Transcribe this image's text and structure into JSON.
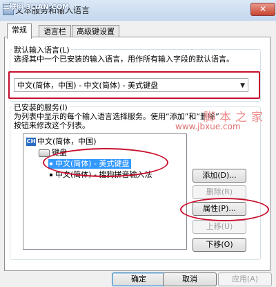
{
  "window": {
    "title": "文本服务和输入语言",
    "watermark_top": "三联网 3LIAN.COM",
    "close_glyph": "✕"
  },
  "tabs": [
    {
      "label": "常规",
      "active": true
    },
    {
      "label": "语言栏",
      "active": false
    },
    {
      "label": "高级键设置",
      "active": false
    }
  ],
  "default_language": {
    "group_label": "默认输入语言(L)",
    "description": "选择其中一个已安装的输入语言，用作所有输入字段的默认语言。",
    "selected_value": "中文(简体，中国) - 中文(简体) - 美式键盘",
    "arrow_glyph": "▼"
  },
  "installed_services": {
    "group_label": "已安装的服务(I)",
    "description_line1": "为列表中显示的每个输入语言选择服务。使用“添加”和“删除”",
    "description_line2": "按钮来修改这个列表。",
    "tree": {
      "language_icon": "CH",
      "language": "中文(简体，中国)",
      "category": "键盘",
      "items": [
        {
          "label": "中文(简体) - 美式键盘",
          "selected": true
        },
        {
          "label": "中文(简体) - 搜狗拼音输入法",
          "selected": false
        }
      ]
    },
    "buttons": {
      "add": "添加(D)...",
      "remove": "删除(R)",
      "properties": "属性(P)...",
      "move_up": "上移(U)",
      "move_down": "下移(O)"
    }
  },
  "watermark": {
    "cn": "脚本之家",
    "url": "www.jbxue.com"
  },
  "footer": {
    "ok": "确定",
    "cancel": "取消",
    "apply": "应用(A)"
  },
  "colors": {
    "annotation_red": "#c8102e",
    "selection_blue": "#3399ff"
  }
}
